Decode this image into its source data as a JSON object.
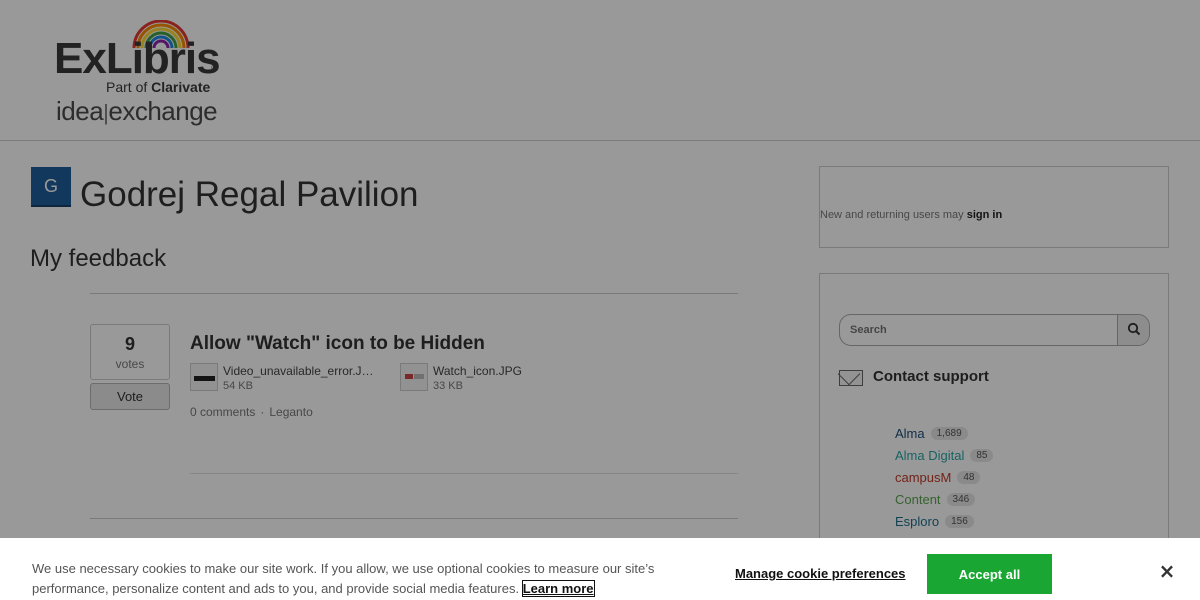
{
  "header": {
    "logo_word": "ExLibris",
    "logo_reg": "®",
    "logo_partof_prefix": "Part of ",
    "logo_partof_brand": "Clarivate",
    "logo_idea": "idea",
    "logo_sep": "|",
    "logo_exchange": "exchange"
  },
  "forum": {
    "avatar_letter": "G",
    "title": "Godrej Regal Pavilion"
  },
  "section": {
    "title": "My feedback"
  },
  "idea": {
    "votes": "9",
    "votes_label": "votes",
    "vote_button": "Vote",
    "title": "Allow \"Watch\" icon to be Hidden",
    "attachments": [
      {
        "name": "Video_unavailable_error.J…",
        "size": "54 KB"
      },
      {
        "name": "Watch_icon.JPG",
        "size": "33 KB"
      }
    ],
    "comments": "0 comments",
    "separator": "·",
    "category": "Leganto"
  },
  "sidebar": {
    "signin_prefix": "New and returning users may ",
    "signin_link": "sign in",
    "search_placeholder": "Search",
    "contact_support": "Contact support",
    "categories": [
      {
        "name": "Alma",
        "count": "1,689",
        "color": "#1f4e79"
      },
      {
        "name": "Alma Digital",
        "count": "85",
        "color": "#2aa5a5"
      },
      {
        "name": "campusM",
        "count": "48",
        "color": "#c0392b"
      },
      {
        "name": "Content",
        "count": "346",
        "color": "#5aa64e"
      },
      {
        "name": "Esploro",
        "count": "156",
        "color": "#1e6f8c"
      }
    ]
  },
  "cookie": {
    "text": "We use necessary cookies to make our site work. If you allow, we use optional cookies to measure our site’s performance, personalize content and ads to you, and provide social media features. ",
    "learn_more": "Learn more",
    "manage": "Manage cookie preferences",
    "accept": "Accept all",
    "close": "×"
  },
  "colors": {
    "accept_green": "#19a633",
    "avatar_blue": "#1f5f9c"
  }
}
